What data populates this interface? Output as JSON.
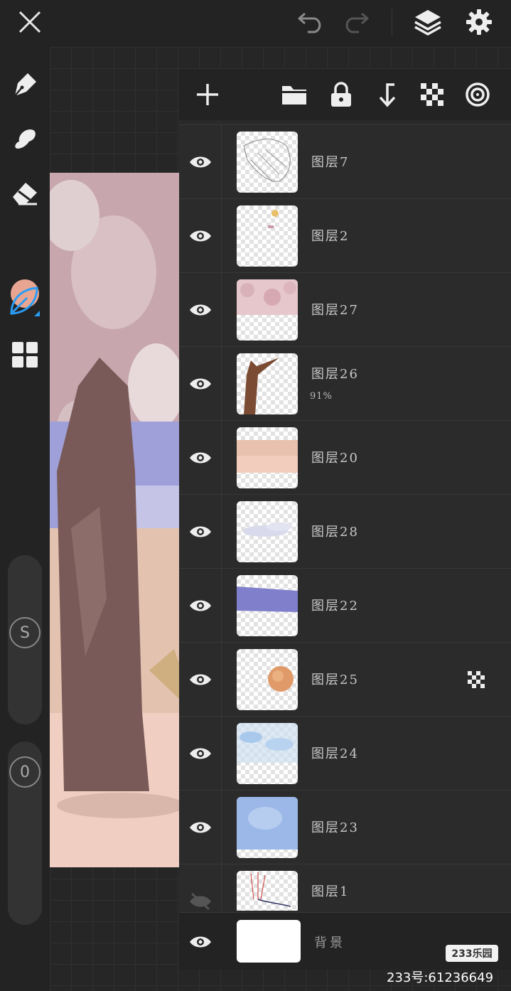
{
  "toolbar": {
    "close_icon": "close-icon",
    "undo_icon": "undo-icon",
    "redo_icon": "redo-icon",
    "layers_icon": "layers-icon",
    "settings_icon": "gear-icon"
  },
  "tools": {
    "items": [
      "pen-icon",
      "smudge-icon",
      "eraser-icon",
      "color-swatch",
      "leaf-brush-icon",
      "grid-icon"
    ],
    "current_color": "#e8a592",
    "active_color": "#2a9df4",
    "size_label": "S",
    "opacity_label": "0"
  },
  "layers_toolbar": {
    "icons": [
      "plus-icon",
      "folder-icon",
      "lock-icon",
      "merge-down-icon",
      "checker-icon",
      "target-icon"
    ]
  },
  "layers": [
    {
      "name": "图层7",
      "opacity": "",
      "visible": true
    },
    {
      "name": "图层2",
      "opacity": "",
      "visible": true
    },
    {
      "name": "图层27",
      "opacity": "",
      "visible": true
    },
    {
      "name": "图层26",
      "opacity": "91%",
      "visible": true
    },
    {
      "name": "图层20",
      "opacity": "",
      "visible": true
    },
    {
      "name": "图层28",
      "opacity": "",
      "visible": true
    },
    {
      "name": "图层22",
      "opacity": "",
      "visible": true
    },
    {
      "name": "图层25",
      "opacity": "",
      "visible": true,
      "clipping": true
    },
    {
      "name": "图层24",
      "opacity": "",
      "visible": true
    },
    {
      "name": "图层23",
      "opacity": "",
      "visible": true
    },
    {
      "name": "图层1",
      "opacity": "",
      "visible": false
    }
  ],
  "background_layer": {
    "name": "背景",
    "visible": true
  },
  "watermark": {
    "logo": "233乐园",
    "id": "233号:61236649"
  }
}
